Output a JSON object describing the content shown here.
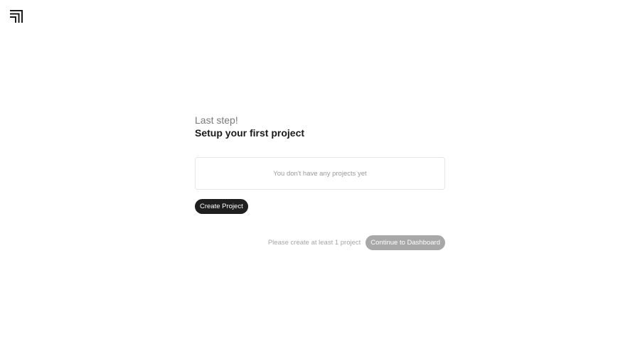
{
  "brand": {
    "logo_icon": "brand-logo-icon"
  },
  "setup": {
    "eyebrow": "Last step!",
    "title": "Setup your first project"
  },
  "projects": {
    "empty_message": "You don't have any projects yet",
    "create_label": "Create Project"
  },
  "footer": {
    "hint": "Please create at least 1 project",
    "continue_label": "Continue to Dashboard",
    "continue_disabled": true
  },
  "colors": {
    "primary_button": "#1f1f1f",
    "disabled_button": "#a8a8a8",
    "muted_text": "#9a9a9a"
  }
}
